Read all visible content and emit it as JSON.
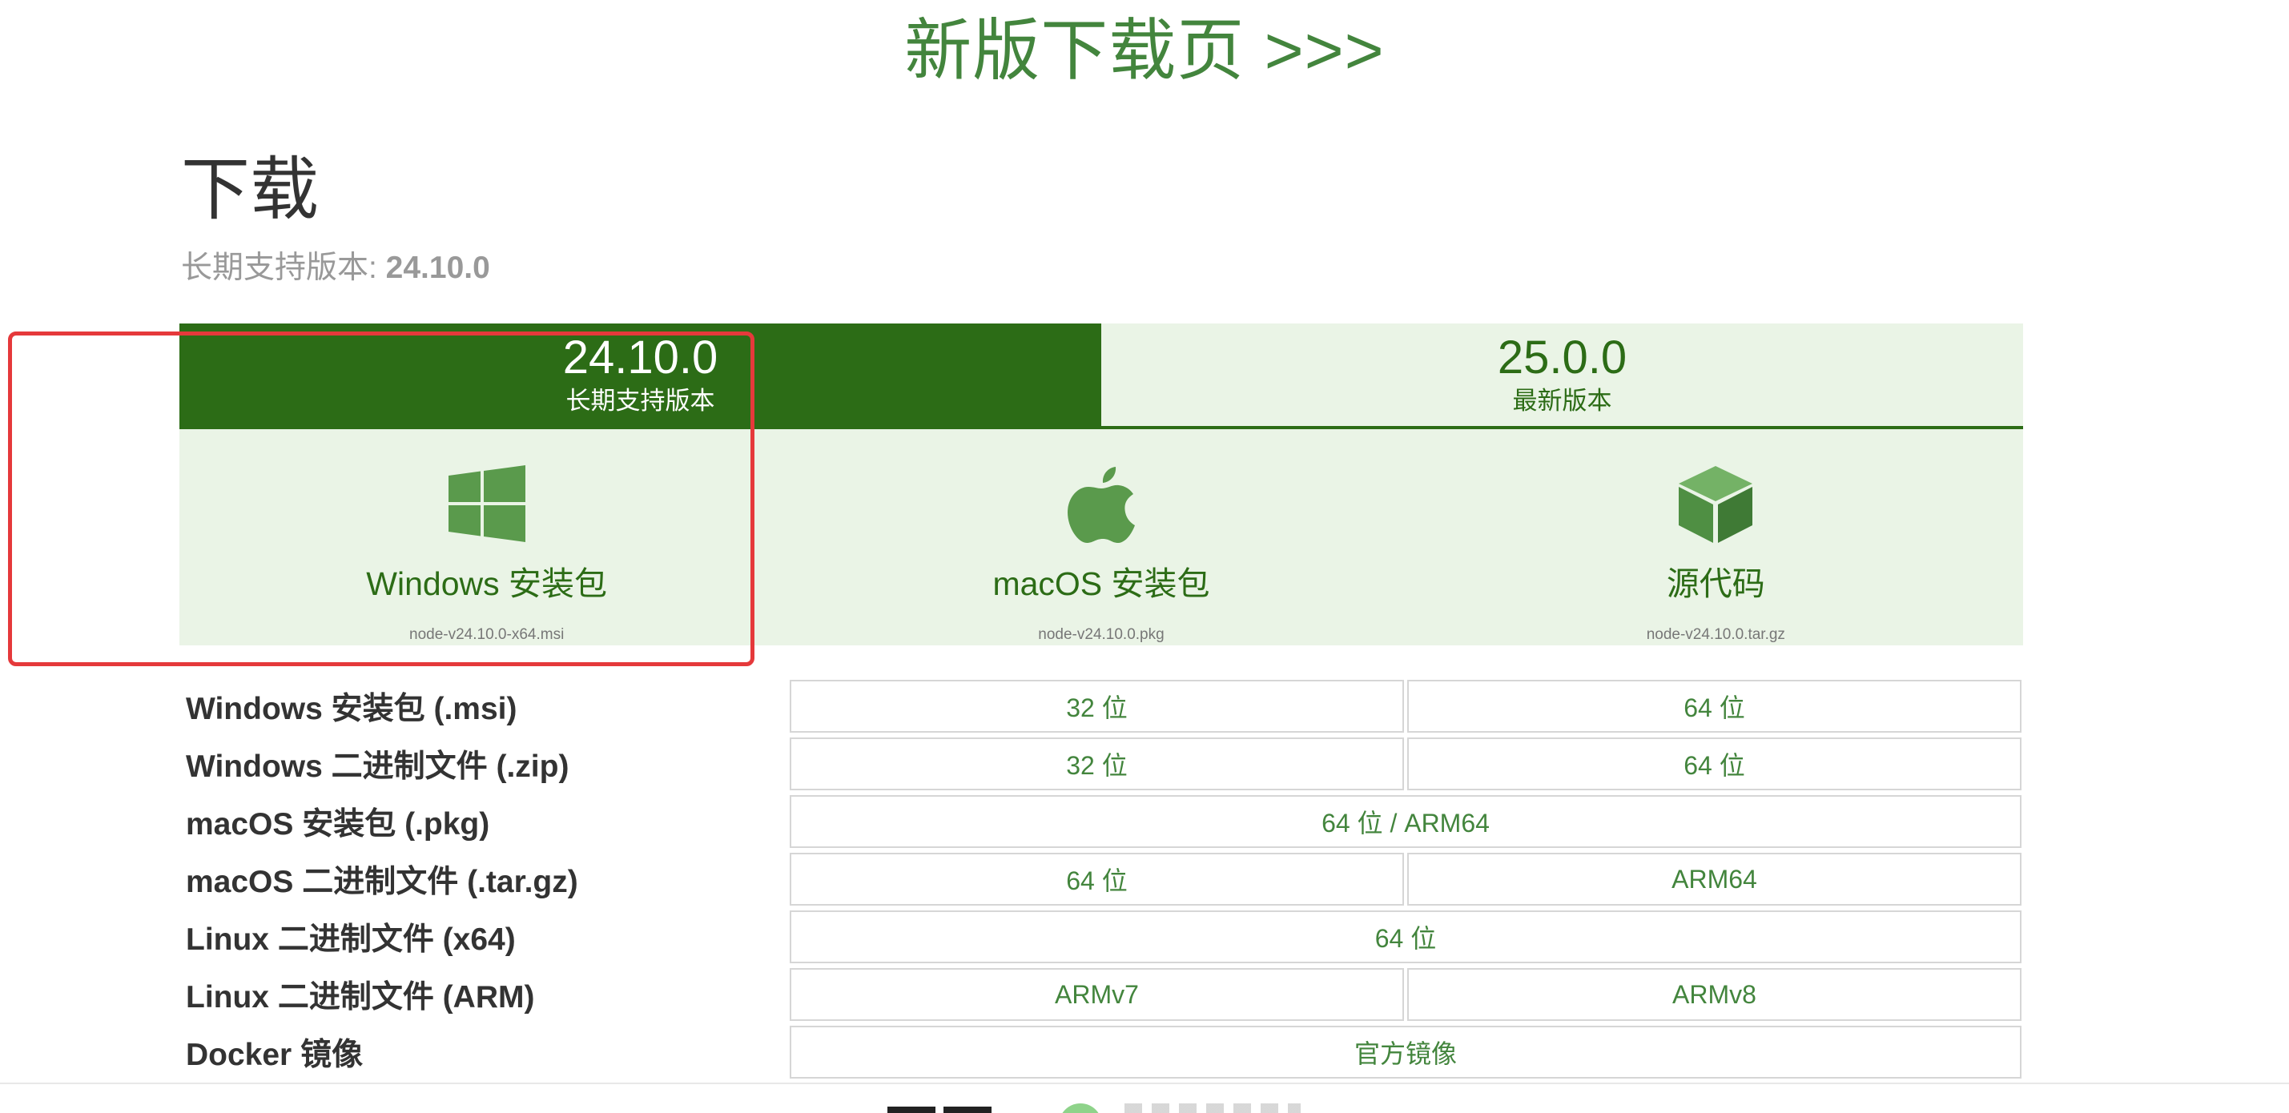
{
  "header": {
    "new_page_link": "新版下载页 >>>"
  },
  "section": {
    "title": "下载",
    "lts_prefix": "长期支持版本: ",
    "lts_version": "24.10.0"
  },
  "tabs": [
    {
      "version": "24.10.0",
      "label": "长期支持版本",
      "active": true
    },
    {
      "version": "25.0.0",
      "label": "最新版本",
      "active": false
    }
  ],
  "cards": [
    {
      "icon": "windows-icon",
      "title": "Windows 安装包",
      "file": "node-v24.10.0-x64.msi"
    },
    {
      "icon": "apple-icon",
      "title": "macOS 安装包",
      "file": "node-v24.10.0.pkg"
    },
    {
      "icon": "box-icon",
      "title": "源代码",
      "file": "node-v24.10.0.tar.gz"
    }
  ],
  "downloads": [
    {
      "label": "Windows 安装包 (.msi)",
      "options": [
        "32 位",
        "64 位"
      ]
    },
    {
      "label": "Windows 二进制文件 (.zip)",
      "options": [
        "32 位",
        "64 位"
      ]
    },
    {
      "label": "macOS 安装包 (.pkg)",
      "options": [
        "64 位 / ARM64"
      ]
    },
    {
      "label": "macOS 二进制文件 (.tar.gz)",
      "options": [
        "64 位",
        "ARM64"
      ]
    },
    {
      "label": "Linux 二进制文件 (x64)",
      "options": [
        "64 位"
      ]
    },
    {
      "label": "Linux 二进制文件 (ARM)",
      "options": [
        "ARMv7",
        "ARMv8"
      ]
    },
    {
      "label": "Docker 镜像",
      "options": [
        "官方镜像"
      ]
    }
  ],
  "colors": {
    "brand_green": "#43853d",
    "dark_green": "#2c6c16",
    "light_green_bg": "#eaf4e6",
    "highlight_red": "#e5393b"
  }
}
